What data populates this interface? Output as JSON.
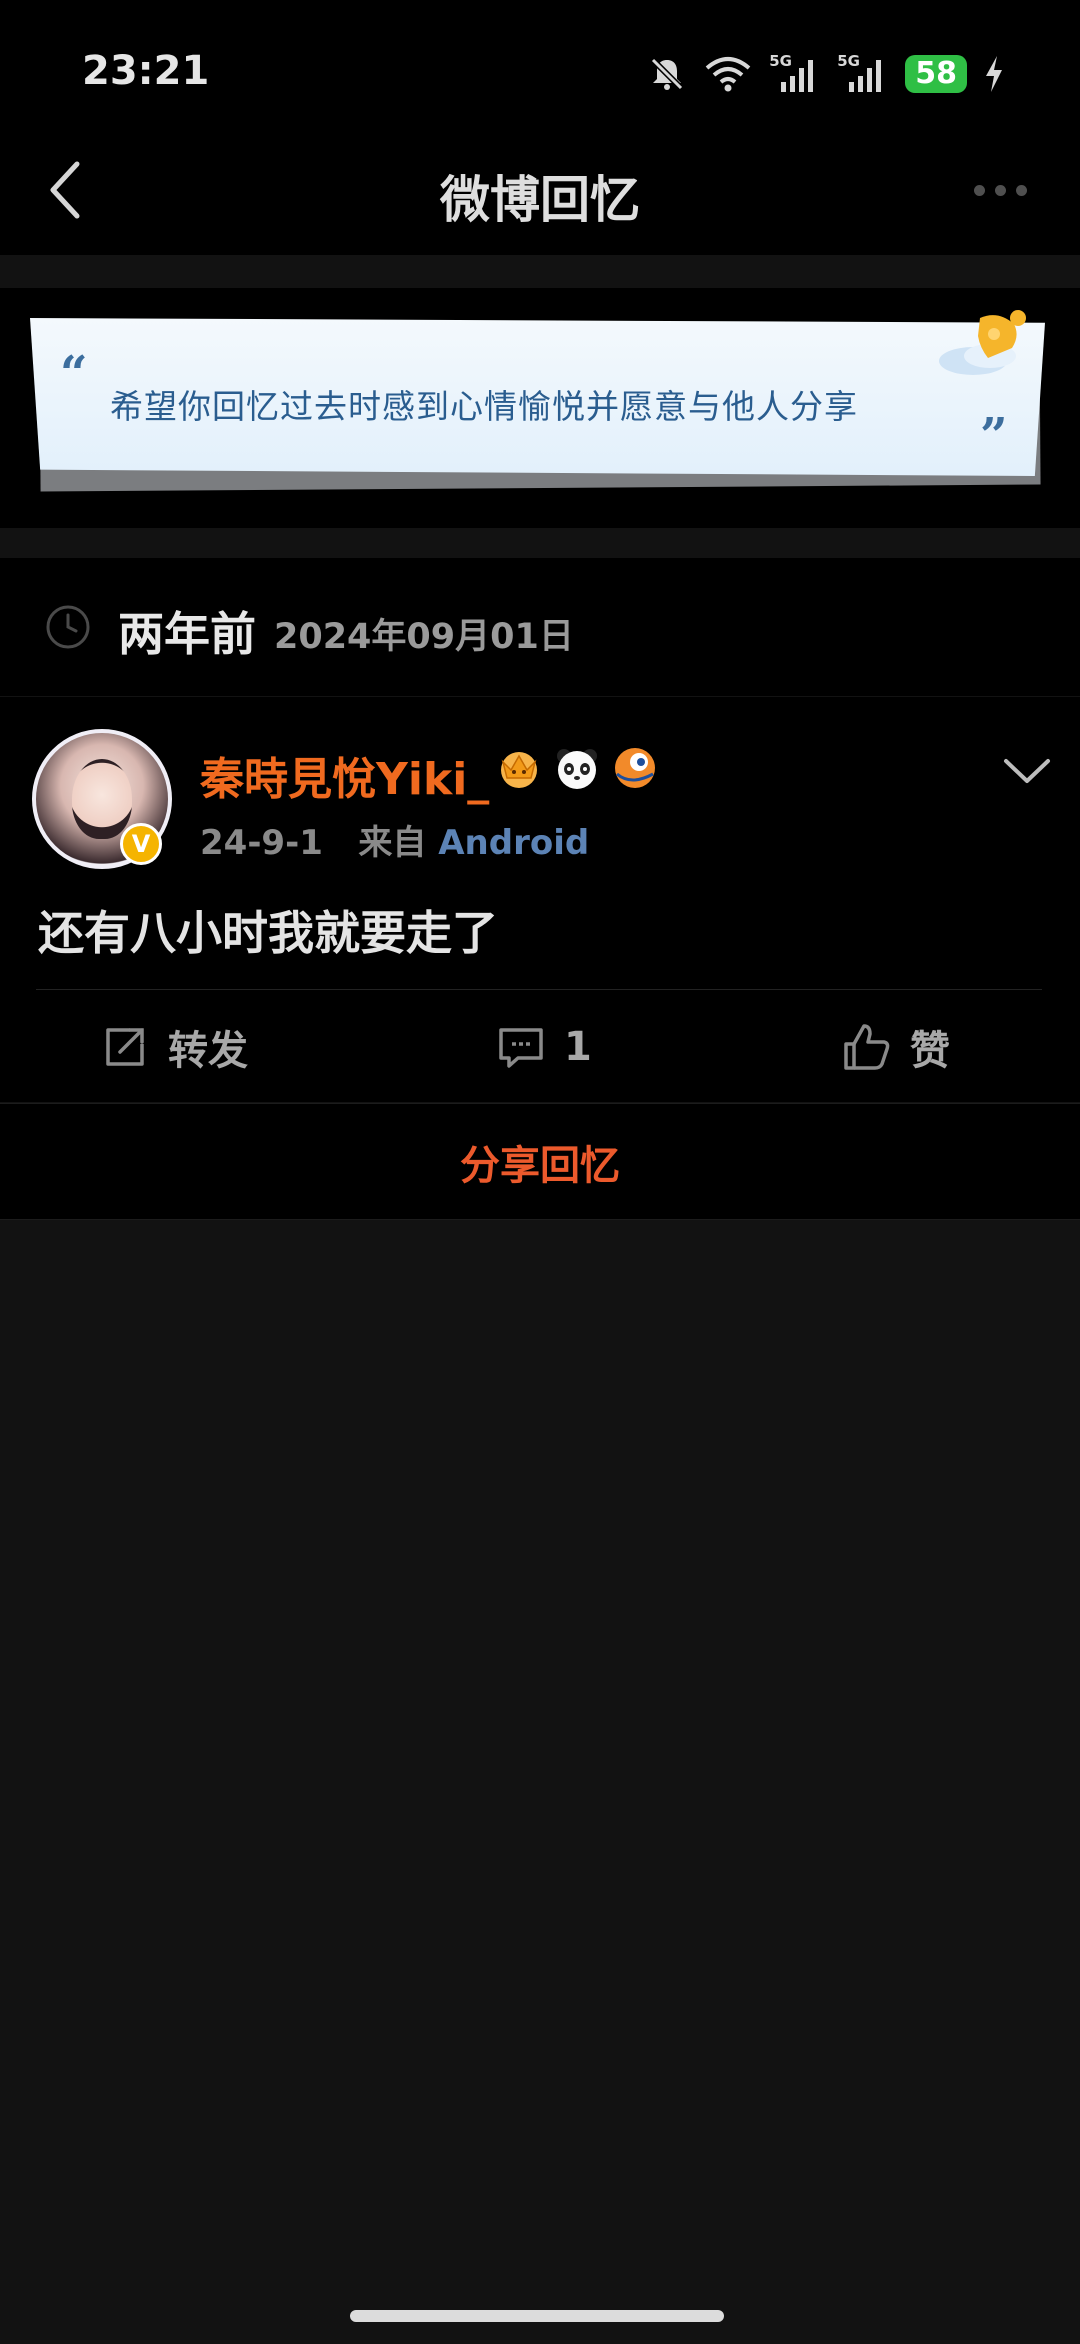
{
  "status_bar": {
    "time": "23:21",
    "network_1": "5G",
    "network_2": "5G",
    "battery": "58",
    "icons": [
      "bell-off-icon",
      "wifi-icon",
      "signal-icon",
      "signal-icon",
      "battery-icon",
      "charging-icon"
    ]
  },
  "nav": {
    "title": "微博回忆",
    "back_icon": "chevron-left-icon",
    "more_icon": "more-dots-icon"
  },
  "banner": {
    "quote_open": "“",
    "quote_close": "”",
    "text": "希望你回忆过去时感到心情愉悦并愿意与他人分享",
    "colors": {
      "paper": "#e8f3fc",
      "text": "#2a5d8f"
    }
  },
  "date_row": {
    "relative": "两年前",
    "date": "2024年09月01日"
  },
  "post": {
    "username": "秦時見悅Yiki_",
    "verified_badge": "V",
    "badges": [
      "crown-badge-icon",
      "panda-badge-icon",
      "fish-badge-icon"
    ],
    "time": "24-9-1",
    "source_prefix": "来自",
    "source": "Android",
    "content": "还有八小时我就要走了",
    "actions": {
      "repost_label": "转发",
      "comment_count": "1",
      "like_label": "赞"
    },
    "colors": {
      "username": "#f06a1f",
      "source": "#5c83b5"
    }
  },
  "share": {
    "label": "分享回忆",
    "color": "#ec5a2c"
  }
}
